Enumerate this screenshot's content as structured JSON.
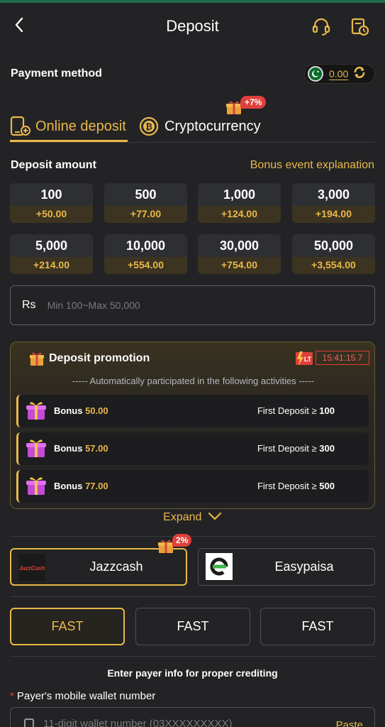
{
  "header": {
    "title": "Deposit"
  },
  "payment_method": {
    "label": "Payment method",
    "balance": "0.00"
  },
  "tabs": [
    {
      "label": "Online deposit",
      "active": true
    },
    {
      "label": "Cryptocurrency",
      "badge": "+7%"
    }
  ],
  "deposit_amount": {
    "label": "Deposit amount",
    "bonus_link": "Bonus event explanation",
    "options": [
      {
        "amount": "100",
        "bonus": "+50.00"
      },
      {
        "amount": "500",
        "bonus": "+77.00"
      },
      {
        "amount": "1,000",
        "bonus": "+124.00"
      },
      {
        "amount": "3,000",
        "bonus": "+194.00"
      },
      {
        "amount": "5,000",
        "bonus": "+214.00"
      },
      {
        "amount": "10,000",
        "bonus": "+554.00"
      },
      {
        "amount": "30,000",
        "bonus": "+754.00"
      },
      {
        "amount": "50,000",
        "bonus": "+3,554.00"
      }
    ],
    "currency": "Rs",
    "placeholder": "Min 100~Max 50,000",
    "value": ""
  },
  "promotion": {
    "title": "Deposit promotion",
    "lt_label": "LT",
    "timer": "15:41:15.7",
    "subtitle": "----- Automatically participated in the following activities -----",
    "rows": [
      {
        "bonus_label": "Bonus",
        "bonus_value": "50.00",
        "condition": "First Deposit ≥",
        "threshold": "100"
      },
      {
        "bonus_label": "Bonus",
        "bonus_value": "57.00",
        "condition": "First Deposit ≥",
        "threshold": "300"
      },
      {
        "bonus_label": "Bonus",
        "bonus_value": "77.00",
        "condition": "First Deposit ≥",
        "threshold": "500"
      }
    ],
    "expand_label": "Expand"
  },
  "channels": [
    {
      "name": "Jazzcash",
      "badge": "2%",
      "logo_text": "JazzCash",
      "active": true
    },
    {
      "name": "Easypaisa",
      "active": false
    }
  ],
  "fast_options": [
    {
      "label": "FAST",
      "active": true
    },
    {
      "label": "FAST",
      "active": false
    },
    {
      "label": "FAST",
      "active": false
    }
  ],
  "payer": {
    "info_title": "Enter payer info for proper crediting",
    "required_mark": "*",
    "wallet_label": "Payer's mobile wallet number",
    "wallet_placeholder": "11-digit wallet number (03XXXXXXXXX)",
    "paste_label": "Paste"
  },
  "colors": {
    "accent": "#e9b84a",
    "background": "#232325",
    "badge_red": "#e0403a"
  }
}
